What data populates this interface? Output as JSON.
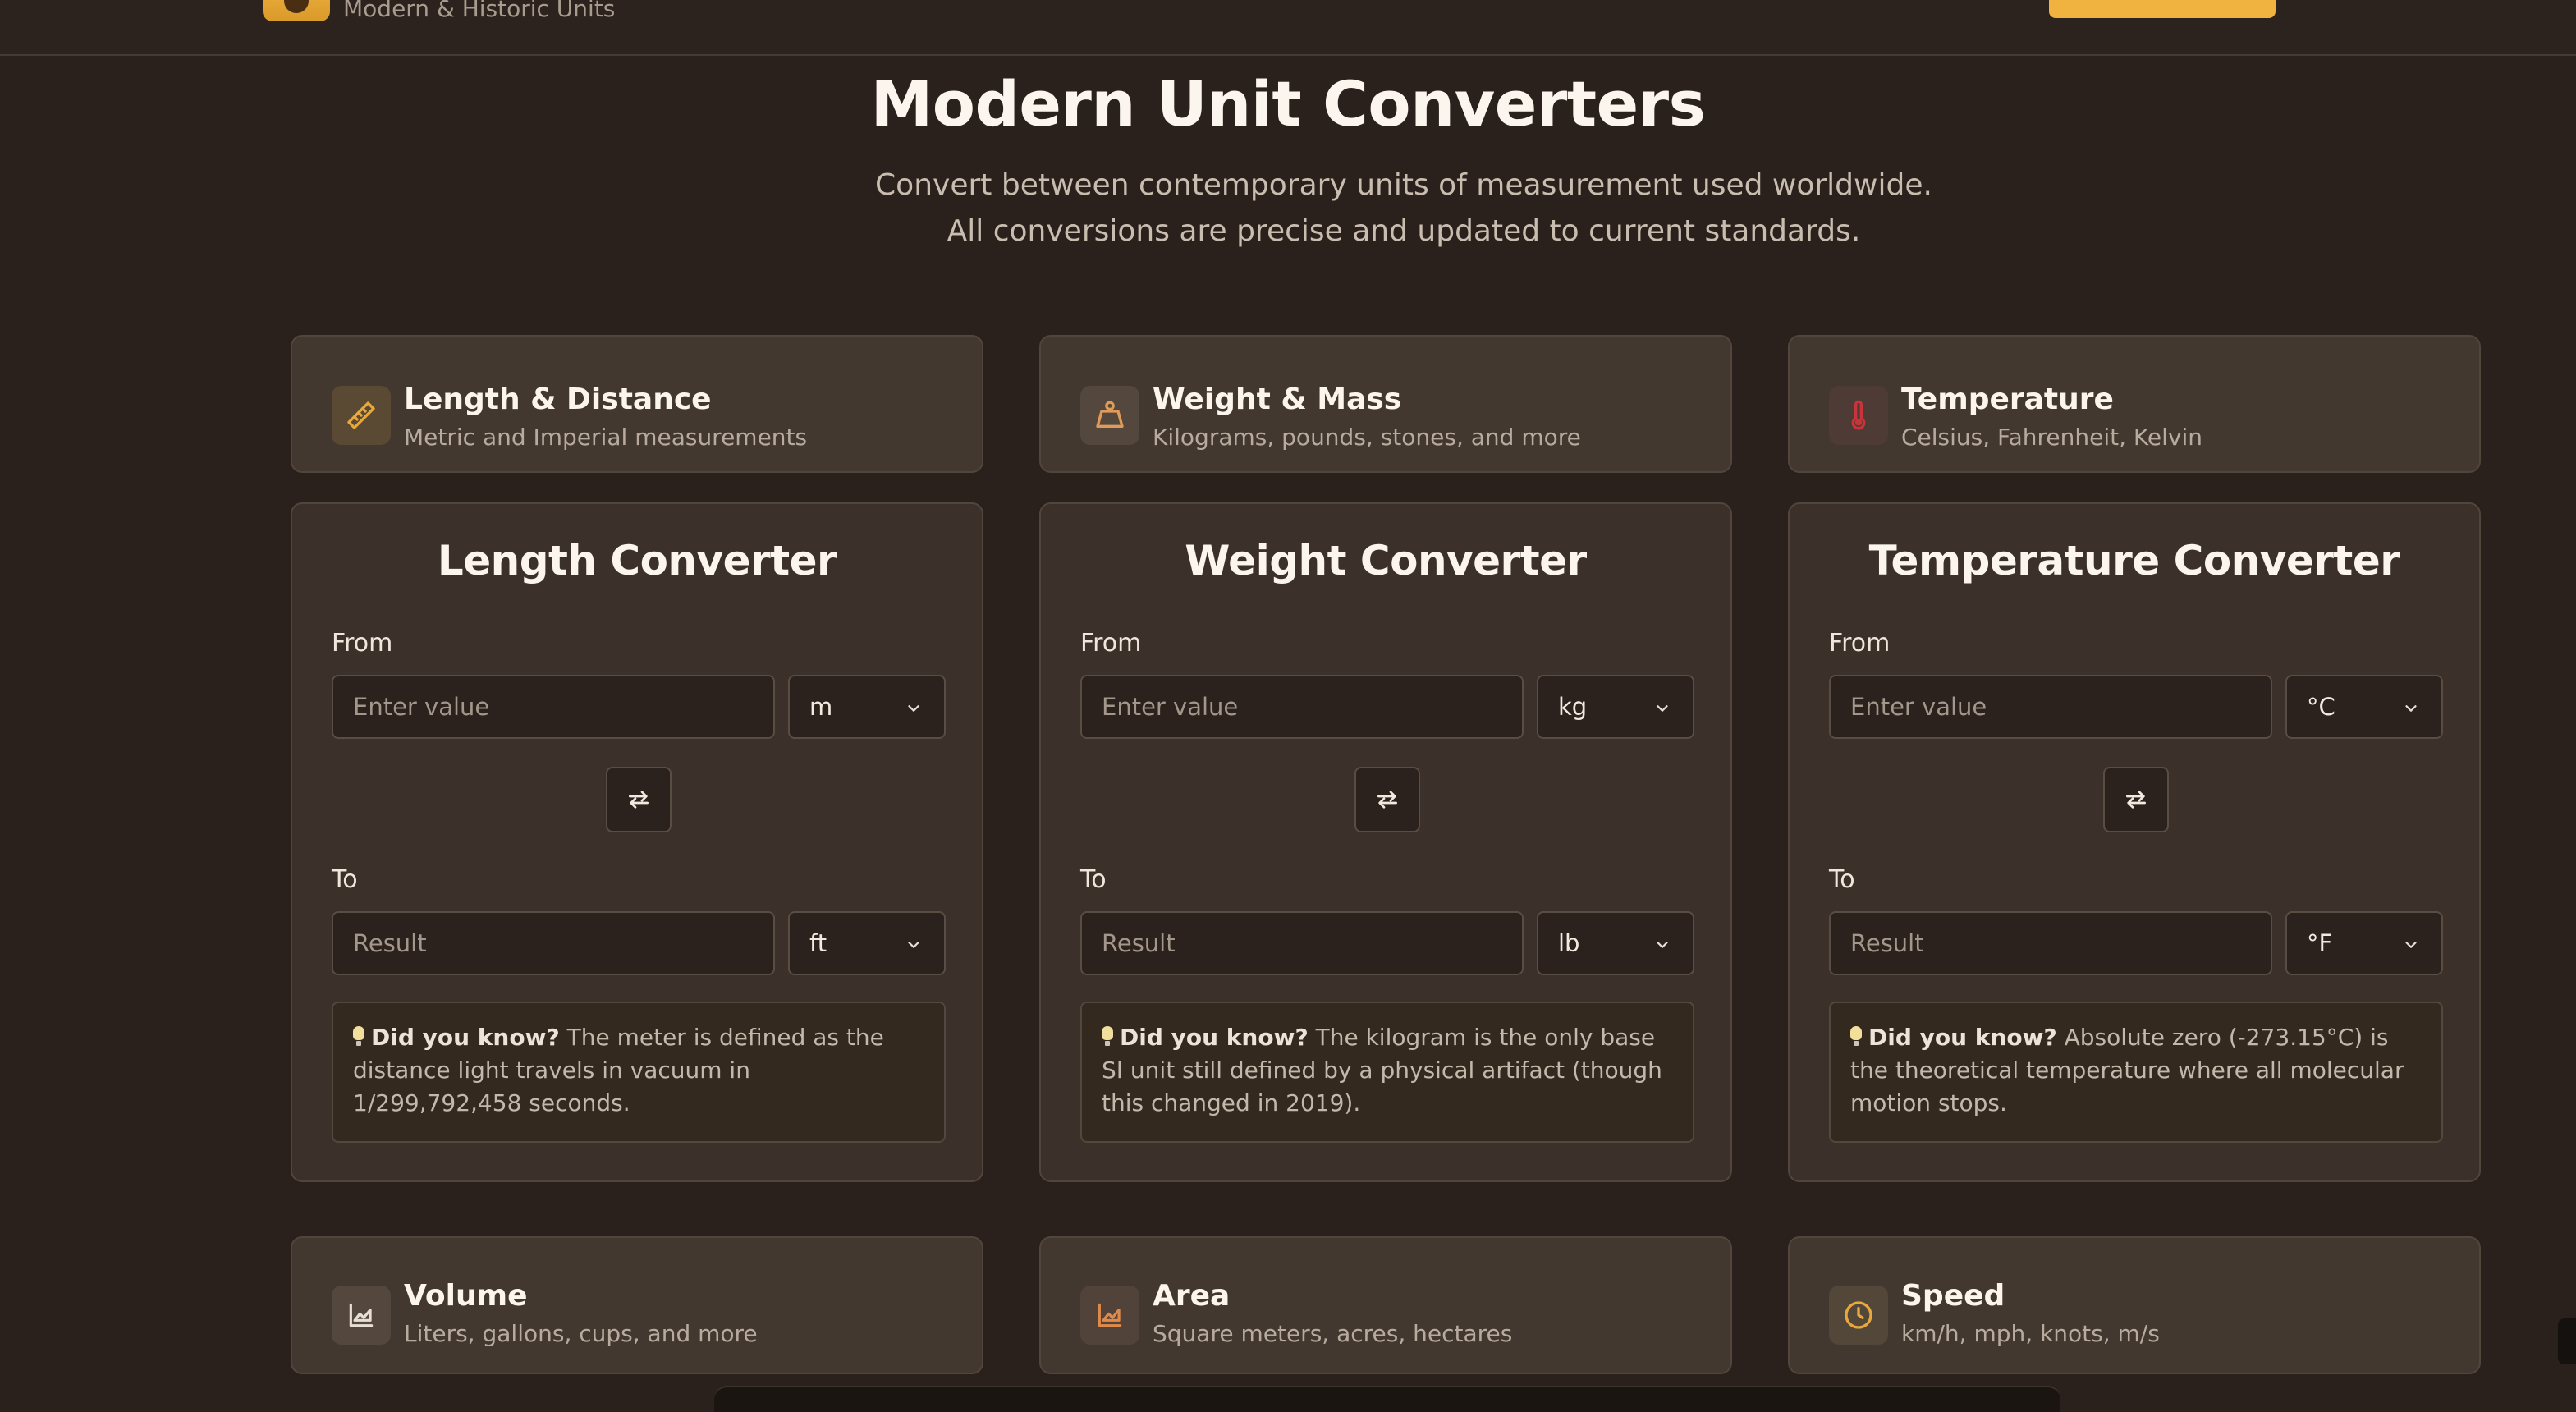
{
  "header": {
    "brand_subtitle": "Modern & Historic Units"
  },
  "hero": {
    "title": "Modern Unit Converters",
    "subtitle": "Convert between contemporary units of measurement used worldwide. All conversions are precise and updated to current standards."
  },
  "categories": [
    {
      "title": "Length & Distance",
      "desc": "Metric and Imperial measurements",
      "icon": "ruler-icon"
    },
    {
      "title": "Weight & Mass",
      "desc": "Kilograms, pounds, stones, and more",
      "icon": "weight-icon"
    },
    {
      "title": "Temperature",
      "desc": "Celsius, Fahrenheit, Kelvin",
      "icon": "thermometer-icon"
    },
    {
      "title": "Volume",
      "desc": "Liters, gallons, cups, and more",
      "icon": "chart-icon"
    },
    {
      "title": "Area",
      "desc": "Square meters, acres, hectares",
      "icon": "chart-icon"
    },
    {
      "title": "Speed",
      "desc": "km/h, mph, knots, m/s",
      "icon": "clock-icon"
    }
  ],
  "converters": [
    {
      "title": "Length Converter",
      "from_label": "From",
      "to_label": "To",
      "from_placeholder": "Enter value",
      "to_placeholder": "Result",
      "from_unit": "m",
      "to_unit": "ft",
      "tip_prefix": "Did you know?",
      "tip_text": "The meter is defined as the distance light travels in vacuum in 1/299,792,458 seconds."
    },
    {
      "title": "Weight Converter",
      "from_label": "From",
      "to_label": "To",
      "from_placeholder": "Enter value",
      "to_placeholder": "Result",
      "from_unit": "kg",
      "to_unit": "lb",
      "tip_prefix": "Did you know?",
      "tip_text": "The kilogram is the only base SI unit still defined by a physical artifact (though this changed in 2019)."
    },
    {
      "title": "Temperature Converter",
      "from_label": "From",
      "to_label": "To",
      "from_placeholder": "Enter value",
      "to_placeholder": "Result",
      "from_unit": "°C",
      "to_unit": "°F",
      "tip_prefix": "Did you know?",
      "tip_text": "Absolute zero (-273.15°C) is the theoretical temperature where all molecular motion stops."
    }
  ],
  "colors": {
    "background": "#2a211c",
    "card": "#433830",
    "accent": "#f1b33f",
    "thermo_red": "#c8343a"
  }
}
